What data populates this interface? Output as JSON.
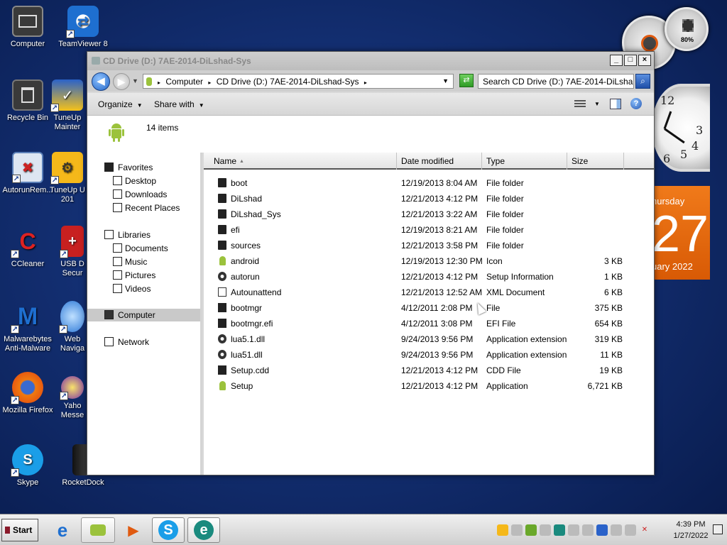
{
  "desktop": {
    "icons": [
      {
        "label": "Computer"
      },
      {
        "label": "TeamViewer 8"
      },
      {
        "label": "Recycle Bin"
      },
      {
        "label": "TuneUp\nMainter"
      },
      {
        "label": "AutorunRem..."
      },
      {
        "label": "TuneUp U\n201"
      },
      {
        "label": "CCleaner"
      },
      {
        "label": "USB D\nSecur"
      },
      {
        "label": "Malwarebytes\nAnti-Malware"
      },
      {
        "label": "Web\nNaviga"
      },
      {
        "label": "Mozilla Firefox"
      },
      {
        "label": "Yaho\nMesse"
      },
      {
        "label": "Skype"
      },
      {
        "label": "RocketDock"
      }
    ]
  },
  "gadgets": {
    "meter_percent": "80%",
    "clock_numbers": [
      "12",
      "3",
      "6",
      "5",
      "4"
    ],
    "calendar": {
      "day": "hursday",
      "date": "27",
      "month": "uary 2022",
      "color": "#e8680f"
    }
  },
  "window": {
    "title": "CD Drive (D:) 7AE-2014-DiLshad-Sys",
    "controls": {
      "minimize": "_",
      "maximize": "□",
      "close": "×"
    },
    "breadcrumbs": [
      "Computer",
      "CD Drive (D:) 7AE-2014-DiLshad-Sys"
    ],
    "search_placeholder": "Search CD Drive (D:) 7AE-2014-DiLsha...",
    "toolbar": {
      "organize": "Organize",
      "share_with": "Share with"
    },
    "details": {
      "items_count": "14 items"
    },
    "nav": {
      "favorites": "Favorites",
      "desktop": "Desktop",
      "downloads": "Downloads",
      "recent_places": "Recent Places",
      "libraries": "Libraries",
      "documents": "Documents",
      "music": "Music",
      "pictures": "Pictures",
      "videos": "Videos",
      "computer": "Computer",
      "network": "Network"
    },
    "columns": {
      "name": "Name",
      "date_modified": "Date modified",
      "type": "Type",
      "size": "Size"
    },
    "files": [
      {
        "name": "boot",
        "date": "12/19/2013 8:04 AM",
        "type": "File folder",
        "size": "",
        "icon": "folder"
      },
      {
        "name": "DiLshad",
        "date": "12/21/2013 4:12 PM",
        "type": "File folder",
        "size": "",
        "icon": "folder"
      },
      {
        "name": "DiLshad_Sys",
        "date": "12/21/2013 3:22 AM",
        "type": "File folder",
        "size": "",
        "icon": "folder"
      },
      {
        "name": "efi",
        "date": "12/19/2013 8:21 AM",
        "type": "File folder",
        "size": "",
        "icon": "folder"
      },
      {
        "name": "sources",
        "date": "12/21/2013 3:58 PM",
        "type": "File folder",
        "size": "",
        "icon": "folder"
      },
      {
        "name": "android",
        "date": "12/19/2013 12:30 PM",
        "type": "Icon",
        "size": "3 KB",
        "icon": "android"
      },
      {
        "name": "autorun",
        "date": "12/21/2013 4:12 PM",
        "type": "Setup Information",
        "size": "1 KB",
        "icon": "gear"
      },
      {
        "name": "Autounattend",
        "date": "12/21/2013 12:52 AM",
        "type": "XML Document",
        "size": "6 KB",
        "icon": "doc"
      },
      {
        "name": "bootmgr",
        "date": "4/12/2011 2:08 PM",
        "type": "File",
        "size": "375 KB",
        "icon": "file"
      },
      {
        "name": "bootmgr.efi",
        "date": "4/12/2011 3:08 PM",
        "type": "EFI File",
        "size": "654 KB",
        "icon": "file"
      },
      {
        "name": "lua5.1.dll",
        "date": "9/24/2013 9:56 PM",
        "type": "Application extension",
        "size": "319 KB",
        "icon": "gear"
      },
      {
        "name": "lua51.dll",
        "date": "9/24/2013 9:56 PM",
        "type": "Application extension",
        "size": "11 KB",
        "icon": "gear"
      },
      {
        "name": "Setup.cdd",
        "date": "12/21/2013 4:12 PM",
        "type": "CDD File",
        "size": "19 KB",
        "icon": "file"
      },
      {
        "name": "Setup",
        "date": "12/21/2013 4:12 PM",
        "type": "Application",
        "size": "6,721 KB",
        "icon": "android"
      }
    ]
  },
  "taskbar": {
    "start_label": "Start",
    "time": "4:39 PM",
    "date": "1/27/2022"
  }
}
